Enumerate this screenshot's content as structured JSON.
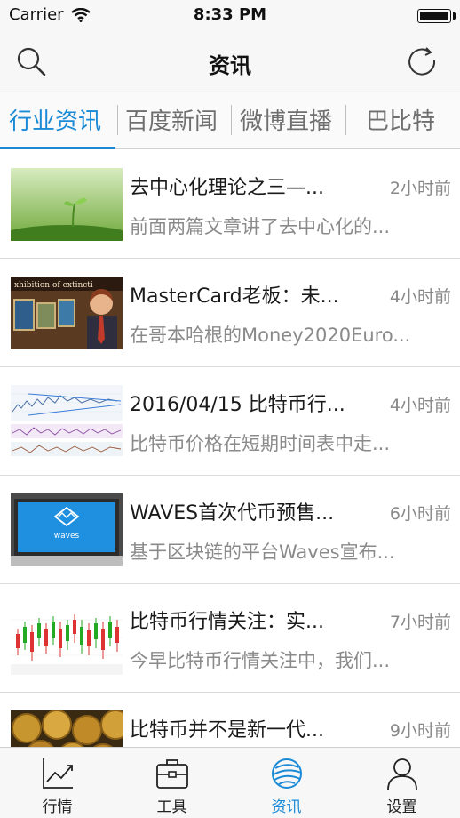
{
  "status_bar": {
    "carrier": "Carrier",
    "time": "8:33 PM",
    "battery_level": 1.0
  },
  "nav": {
    "title": "资讯",
    "left_icon": "search-icon",
    "right_icon": "refresh-icon"
  },
  "tabs": [
    {
      "label": "行业资讯",
      "active": true
    },
    {
      "label": "百度新闻",
      "active": false
    },
    {
      "label": "微博直播",
      "active": false
    },
    {
      "label": "巴比特",
      "active": false
    }
  ],
  "news": [
    {
      "title": "去中心化理论之三—...",
      "time": "2小时前",
      "summary": "前面两篇文章讲了去中心化的..."
    },
    {
      "title": "MasterCard老板：未...",
      "time": "4小时前",
      "summary": "在哥本哈根的Money2020Euro..."
    },
    {
      "title": "2016/04/15 比特币行...",
      "time": "4小时前",
      "summary": "比特币价格在短期时间表中走..."
    },
    {
      "title": "WAVES首次代币预售...",
      "time": "6小时前",
      "summary": "基于区块链的平台Waves宣布..."
    },
    {
      "title": "比特币行情关注：实...",
      "time": "7小时前",
      "summary": "今早比特币行情关注中，我们..."
    },
    {
      "title": "比特币并不是新一代...",
      "time": "9小时前",
      "summary": ""
    }
  ],
  "thumbnails": {
    "image_text_1": "xhibition of  extincti",
    "image_text_2": "waves"
  },
  "tab_bar": [
    {
      "label": "行情",
      "icon": "chart-icon",
      "active": false
    },
    {
      "label": "工具",
      "icon": "toolbox-icon",
      "active": false
    },
    {
      "label": "资讯",
      "icon": "globe-icon",
      "active": true
    },
    {
      "label": "设置",
      "icon": "person-icon",
      "active": false
    }
  ],
  "colors": {
    "accent": "#1a8ad6",
    "bar_background": "#f7f7f7"
  }
}
